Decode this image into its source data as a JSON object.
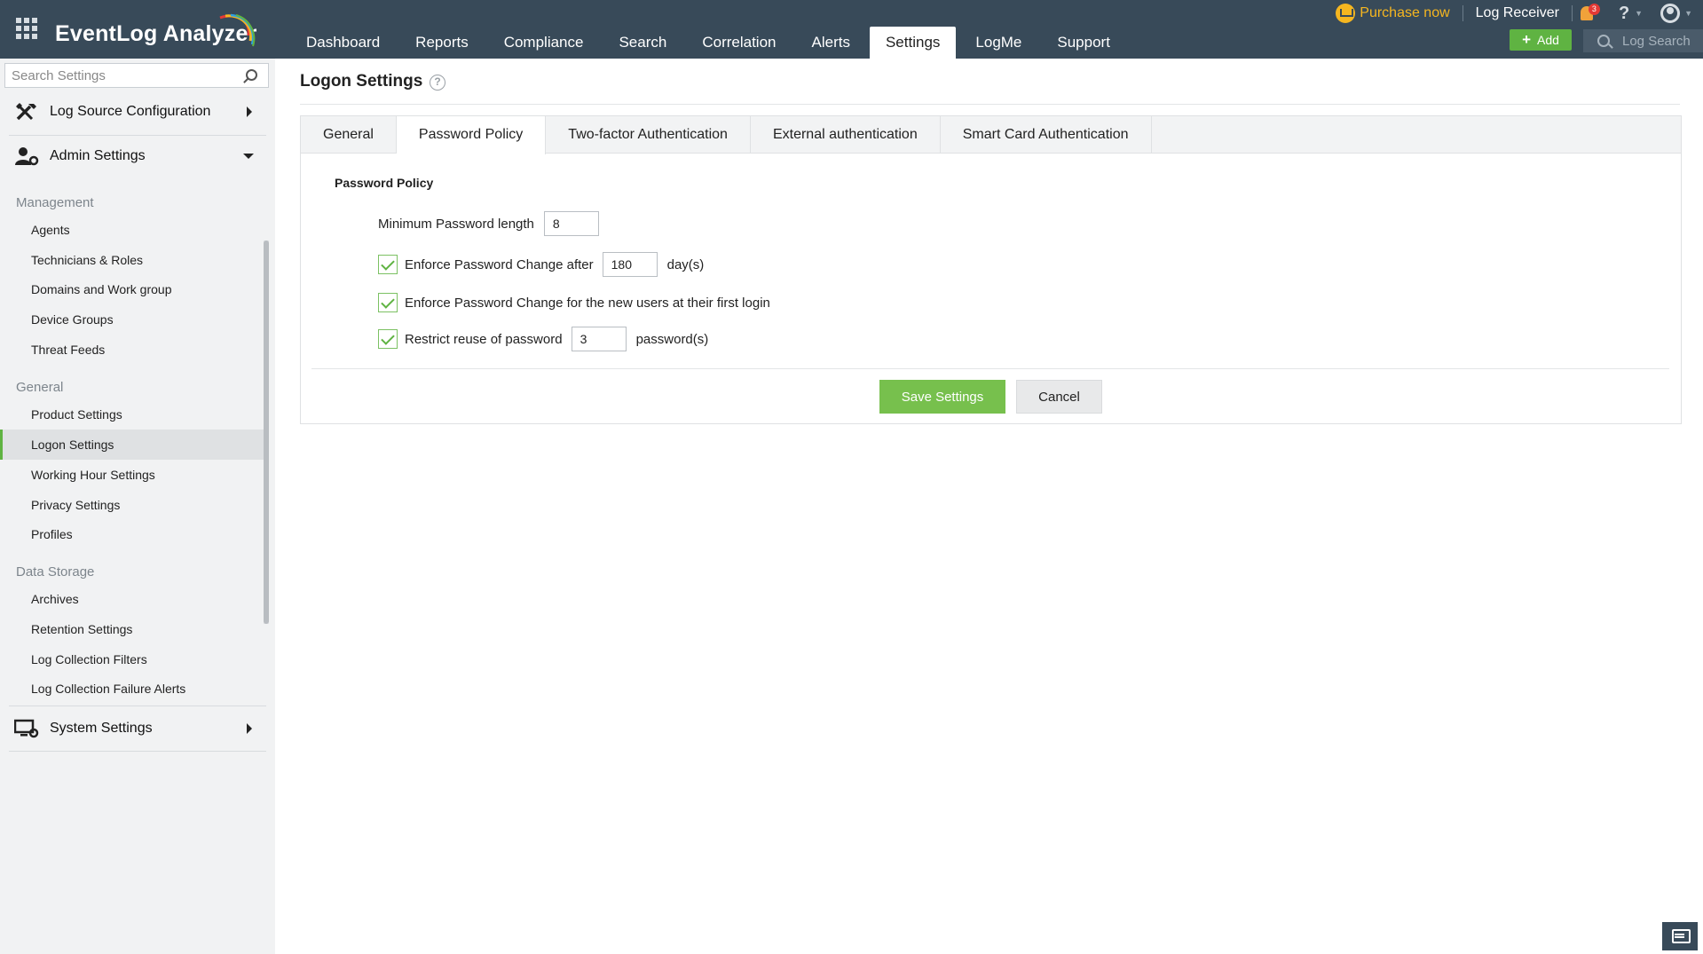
{
  "app": {
    "title": "EventLog Analyzer"
  },
  "nav": {
    "items": [
      "Dashboard",
      "Reports",
      "Compliance",
      "Search",
      "Correlation",
      "Alerts",
      "Settings",
      "LogMe",
      "Support"
    ],
    "active": "Settings"
  },
  "topbar": {
    "purchase_label": "Purchase now",
    "log_receiver_label": "Log Receiver",
    "notification_count": "3",
    "help_label": "?",
    "add_label": "Add",
    "log_search_label": "Log Search",
    "icons": [
      "apps-grid-icon",
      "cart-icon",
      "bell-icon",
      "help-icon",
      "user-icon",
      "plus-icon",
      "search-icon",
      "chat-icon"
    ]
  },
  "sidebar": {
    "search_placeholder": "Search Settings",
    "sections": [
      {
        "label": "Log Source Configuration",
        "icon": "tools-icon",
        "expanded": false
      },
      {
        "label": "Admin Settings",
        "icon": "admin-user-gear-icon",
        "expanded": true
      },
      {
        "label": "System Settings",
        "icon": "monitor-gear-icon",
        "expanded": false
      }
    ],
    "groups": [
      {
        "label": "Management",
        "items": [
          "Agents",
          "Technicians & Roles",
          "Domains and Work group",
          "Device Groups",
          "Threat Feeds"
        ]
      },
      {
        "label": "General",
        "items": [
          "Product Settings",
          "Logon Settings",
          "Working Hour Settings",
          "Privacy Settings",
          "Profiles"
        ]
      },
      {
        "label": "Data Storage",
        "items": [
          "Archives",
          "Retention Settings",
          "Log Collection Filters",
          "Log Collection Failure Alerts"
        ]
      }
    ],
    "active_item": "Logon Settings"
  },
  "page": {
    "title": "Logon Settings",
    "help": "?"
  },
  "tabs": [
    "General",
    "Password Policy",
    "Two-factor Authentication",
    "External authentication",
    "Smart Card Authentication"
  ],
  "active_tab": "Password Policy",
  "form": {
    "section_title": "Password Policy",
    "min_length_label": "Minimum Password length",
    "min_length_value": "8",
    "enforce_change_label": "Enforce Password Change after",
    "enforce_change_value": "180",
    "enforce_change_unit": "day(s)",
    "enforce_change_checked": true,
    "first_login_label": "Enforce Password Change for the new users at their first login",
    "first_login_checked": true,
    "restrict_reuse_label": "Restrict reuse of password",
    "restrict_reuse_value": "3",
    "restrict_reuse_unit": "password(s)",
    "restrict_reuse_checked": true,
    "save_label": "Save Settings",
    "cancel_label": "Cancel"
  },
  "colors": {
    "header_bg": "#384a59",
    "accent_green": "#77c04d",
    "purchase_gold": "#f5b620",
    "sidebar_bg": "#f1f2f3"
  }
}
